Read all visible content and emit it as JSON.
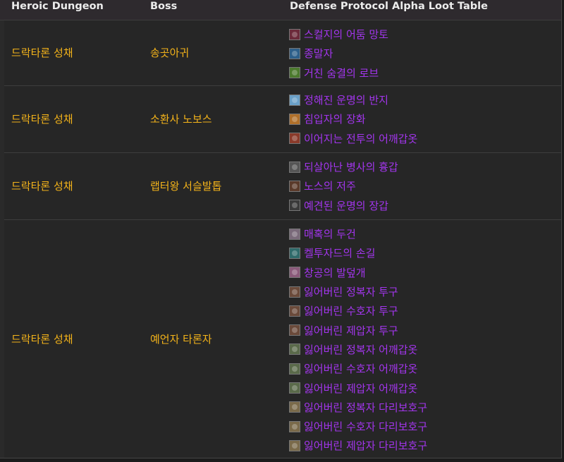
{
  "header": {
    "dungeon": "Heroic Dungeon",
    "boss": "Boss",
    "loot": "Defense Protocol Alpha Loot Table"
  },
  "rows": [
    {
      "dungeon": "드락타론 성채",
      "boss": "송곳아귀",
      "items": [
        {
          "name": "스컬지의 어둠 망토",
          "icon": "cloak-icon",
          "color": "#6b2a3a"
        },
        {
          "name": "종말자",
          "icon": "weapon-icon",
          "color": "#2d5f8a"
        },
        {
          "name": "거친 숨결의 로브",
          "icon": "robe-icon",
          "color": "#4c7a2e"
        }
      ]
    },
    {
      "dungeon": "드락타론 성채",
      "boss": "소환사 노보스",
      "items": [
        {
          "name": "정해진 운명의 반지",
          "icon": "ring-icon",
          "color": "#6aa0c8"
        },
        {
          "name": "침입자의 장화",
          "icon": "boots-icon",
          "color": "#b0702a"
        },
        {
          "name": "이어지는 전투의 어깨갑옷",
          "icon": "shoulder-icon",
          "color": "#8a3a2a"
        }
      ]
    },
    {
      "dungeon": "드락타론 성채",
      "boss": "랩터왕 서슬발톱",
      "items": [
        {
          "name": "되살아난 병사의 흉갑",
          "icon": "chest-icon",
          "color": "#555555"
        },
        {
          "name": "노스의 저주",
          "icon": "dagger-icon",
          "color": "#5a3a2a"
        },
        {
          "name": "예견된 운명의 장갑",
          "icon": "gloves-icon",
          "color": "#3a3a3a"
        }
      ]
    },
    {
      "dungeon": "드락타론 성채",
      "boss": "예언자 타론자",
      "items": [
        {
          "name": "매혹의 두건",
          "icon": "hood-icon",
          "color": "#7a6a7a"
        },
        {
          "name": "켈투자드의 손길",
          "icon": "wand-icon",
          "color": "#2f6a6a"
        },
        {
          "name": "창공의 발덮개",
          "icon": "feet-icon",
          "color": "#8a5a7a"
        },
        {
          "name": "잃어버린 정복자 투구",
          "icon": "helm-token-icon",
          "color": "#6a4a3a"
        },
        {
          "name": "잃어버린 수호자 투구",
          "icon": "helm-token-icon",
          "color": "#6a4a3a"
        },
        {
          "name": "잃어버린 제압자 투구",
          "icon": "helm-token-icon",
          "color": "#6a4a3a"
        },
        {
          "name": "잃어버린 정복자 어깨갑옷",
          "icon": "shoulder-token-icon",
          "color": "#5a6a4a"
        },
        {
          "name": "잃어버린 수호자 어깨갑옷",
          "icon": "shoulder-token-icon",
          "color": "#5a6a4a"
        },
        {
          "name": "잃어버린 제압자 어깨갑옷",
          "icon": "shoulder-token-icon",
          "color": "#5a6a4a"
        },
        {
          "name": "잃어버린 정복자 다리보호구",
          "icon": "legs-token-icon",
          "color": "#7a6a4a"
        },
        {
          "name": "잃어버린 수호자 다리보호구",
          "icon": "legs-token-icon",
          "color": "#7a6a4a"
        },
        {
          "name": "잃어버린 제압자 다리보호구",
          "icon": "legs-token-icon",
          "color": "#7a6a4a"
        }
      ]
    }
  ]
}
